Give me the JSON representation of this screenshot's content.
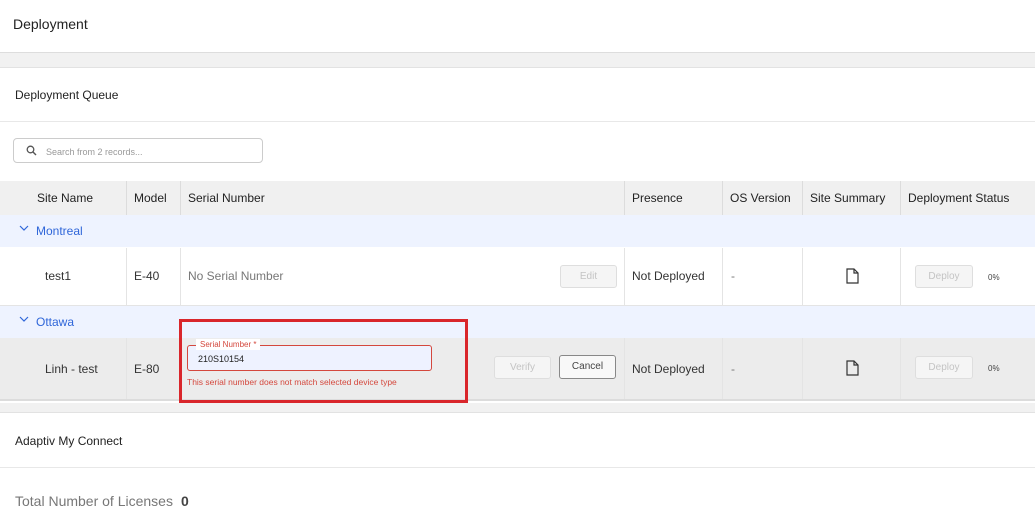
{
  "page": {
    "title": "Deployment"
  },
  "queue": {
    "title": "Deployment Queue",
    "search_placeholder": "Search from 2 records...",
    "columns": [
      "Site Name",
      "Model",
      "Serial Number",
      "Presence",
      "OS Version",
      "Site Summary",
      "Deployment Status"
    ],
    "groups": [
      {
        "name": "Montreal",
        "row": {
          "site_name": "test1",
          "model": "E-40",
          "serial": "No Serial Number",
          "edit_label": "Edit",
          "presence": "Not Deployed",
          "os_version": "-",
          "deploy_label": "Deploy",
          "progress": "0%"
        }
      },
      {
        "name": "Ottawa",
        "row": {
          "site_name": "Linh - test",
          "model": "E-80",
          "serial_field_label": "Serial Number *",
          "serial_value": "210S10154",
          "error": "This serial number does not match selected device type",
          "verify_label": "Verify",
          "cancel_label": "Cancel",
          "presence": "Not Deployed",
          "os_version": "-",
          "deploy_label": "Deploy",
          "progress": "0%"
        }
      }
    ]
  },
  "connect": {
    "title": "Adaptiv My Connect",
    "licenses_label": "Total Number of Licenses",
    "licenses_value": "0"
  },
  "colors": {
    "accent": "#2f66d9",
    "error": "#d4483d",
    "highlight": "#d9262b"
  }
}
